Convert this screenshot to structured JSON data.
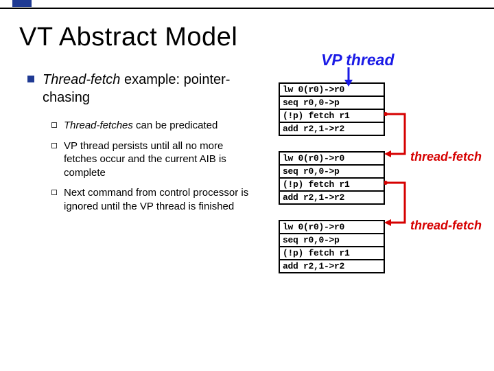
{
  "title": "VT Abstract Model",
  "labels": {
    "vp_thread": "VP thread",
    "thread_fetch": "thread-fetch"
  },
  "bullets": {
    "l1_prefix_em": "Thread-fetch",
    "l1_rest": " example: pointer-chasing",
    "l2": [
      {
        "em": "Thread-fetches",
        "rest": " can be predicated"
      },
      {
        "em": "",
        "rest": "VP thread persists until all no more fetches occur and the current AIB is complete"
      },
      {
        "em": "",
        "rest": "Next command from control processor is ignored until the VP thread is finished"
      }
    ]
  },
  "code": {
    "lines": [
      "lw 0(r0)->r0",
      "seq r0,0->p",
      "(!p) fetch r1",
      "add r2,1->r2"
    ]
  }
}
